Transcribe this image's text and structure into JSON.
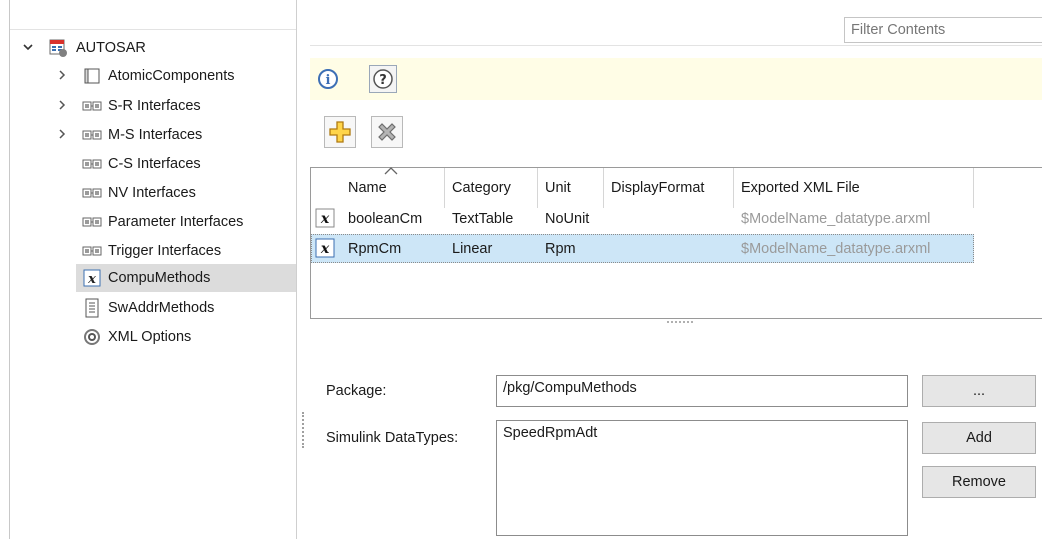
{
  "tree": {
    "root": {
      "label": "AUTOSAR",
      "expanded": true
    },
    "items": [
      {
        "label": "AtomicComponents",
        "icon": "component-icon",
        "expandable": true
      },
      {
        "label": "S-R Interfaces",
        "icon": "interface-icon",
        "expandable": true
      },
      {
        "label": "M-S Interfaces",
        "icon": "interface-icon",
        "expandable": true
      },
      {
        "label": "C-S Interfaces",
        "icon": "interface-icon",
        "expandable": false
      },
      {
        "label": "NV Interfaces",
        "icon": "interface-icon",
        "expandable": false
      },
      {
        "label": "Parameter Interfaces",
        "icon": "interface-icon",
        "expandable": false
      },
      {
        "label": "Trigger Interfaces",
        "icon": "interface-icon",
        "expandable": false
      },
      {
        "label": "CompuMethods",
        "icon": "function-x-icon",
        "expandable": false,
        "selected": true
      },
      {
        "label": "SwAddrMethods",
        "icon": "document-list-icon",
        "expandable": false
      },
      {
        "label": "XML Options",
        "icon": "gear-icon",
        "expandable": false
      }
    ]
  },
  "filter": {
    "placeholder": "Filter Contents"
  },
  "toolbar": {
    "info_icon": "info-icon",
    "help_icon": "help-icon",
    "add_icon": "add-icon",
    "delete_icon": "delete-icon"
  },
  "table": {
    "columns": [
      "Name",
      "Category",
      "Unit",
      "DisplayFormat",
      "Exported XML File"
    ],
    "rows": [
      {
        "name": "booleanCm",
        "category": "TextTable",
        "unit": "NoUnit",
        "display_format": "",
        "xml_file": "$ModelName_datatype.arxml"
      },
      {
        "name": "RpmCm",
        "category": "Linear",
        "unit": "Rpm",
        "display_format": "",
        "xml_file": "$ModelName_datatype.arxml",
        "selected": true
      }
    ]
  },
  "form": {
    "package_label": "Package:",
    "package_value": "/pkg/CompuMethods",
    "browse_label": "...",
    "datatypes_label": "Simulink DataTypes:",
    "datatypes": [
      "SpeedRpmAdt"
    ],
    "add_label": "Add",
    "remove_label": "Remove"
  },
  "colors": {
    "info_bar": "#fffde6",
    "selected_row": "#cde6f7",
    "tree_selected": "#dcdcdc",
    "muted_text": "#9a9a9a"
  }
}
